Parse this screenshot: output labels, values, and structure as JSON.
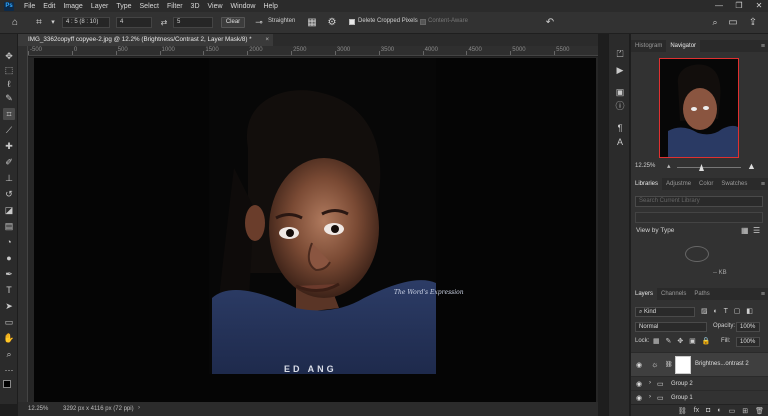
{
  "menubar": {
    "logo": "Ps",
    "items": [
      "File",
      "Edit",
      "Image",
      "Layer",
      "Type",
      "Select",
      "Filter",
      "3D",
      "View",
      "Window",
      "Help"
    ],
    "controls": {
      "minimize": "—",
      "restore": "❐",
      "close": "✕"
    }
  },
  "options": {
    "ratio_value": "4 : 5 (8 : 10)",
    "width_value": "4",
    "height_value": "5",
    "clear_label": "Clear",
    "straighten_label": "Straighten",
    "delete_cropped_label": "Delete Cropped Pixels",
    "content_aware_label": "Content-Aware"
  },
  "document": {
    "tab_title": "IMG_3362copyff copyee-2.jpg @ 12.2% (Brightness/Contrast 2, Layer Mask/8) *",
    "tab_close": "×",
    "ruler_labels": [
      "-500",
      "0",
      "500",
      "1000",
      "1500",
      "2000",
      "2500",
      "3000",
      "3500",
      "4000",
      "4500",
      "5000",
      "5500"
    ],
    "shirt_text": "The Word's Expression"
  },
  "status": {
    "zoom": "12.25%",
    "doc_size": "3292 px x 4116 px (72 ppi)"
  },
  "navigator": {
    "tabs": [
      "Histogram",
      "Navigator"
    ],
    "active_tab": "Navigator",
    "zoom": "12.25%"
  },
  "libraries": {
    "tabs": [
      "Libraries",
      "Adjustme",
      "Color",
      "Swatches"
    ],
    "active_tab": "Libraries",
    "search_placeholder": "Search Current Library",
    "view_by": "View by Type",
    "size_label": "-- KB"
  },
  "layers": {
    "tabs": [
      "Layers",
      "Channels",
      "Paths"
    ],
    "active_tab": "Layers",
    "kind_label": "Kind",
    "blend_mode": "Normal",
    "opacity_label": "Opacity:",
    "opacity_value": "100%",
    "lock_label": "Lock:",
    "fill_label": "Fill:",
    "fill_value": "100%",
    "rows": [
      {
        "name": "Brightnes...ontrast 2",
        "type": "adjustment"
      },
      {
        "name": "Group 2",
        "type": "group"
      },
      {
        "name": "Group 1",
        "type": "group"
      }
    ],
    "footer_icons": [
      "link-icon",
      "fx-icon",
      "mask-icon",
      "adjustment-icon",
      "folder-icon",
      "new-layer-icon",
      "trash-icon"
    ]
  },
  "colors": {
    "accent": "#31a8ff",
    "nav_frame": "#e03030"
  }
}
